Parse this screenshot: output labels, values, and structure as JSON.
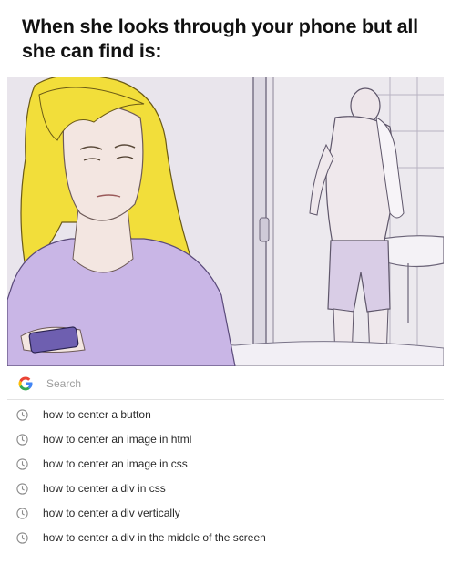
{
  "meme": {
    "caption": "When she looks through your phone but all she can find is:"
  },
  "illustration": {
    "description_icon": "comic-couple-illustration"
  },
  "search": {
    "logo_icon": "google-g-icon",
    "placeholder": "Search"
  },
  "suggestions": [
    {
      "text": "how to center a button",
      "icon": "history-clock-icon"
    },
    {
      "text": "how to center an image in html",
      "icon": "history-clock-icon"
    },
    {
      "text": "how to center an image in css",
      "icon": "history-clock-icon"
    },
    {
      "text": "how to center a div in css",
      "icon": "history-clock-icon"
    },
    {
      "text": "how to center a div vertically",
      "icon": "history-clock-icon"
    },
    {
      "text": "how to center a div in the middle of the screen",
      "icon": "history-clock-icon"
    }
  ],
  "colors": {
    "hair": "#f2de3a",
    "shirt": "#c9b6e6",
    "skin": "#f3e6e1",
    "wall": "#ece9ee",
    "phone": "#6e5fb0",
    "google_blue": "#4285f4",
    "google_red": "#ea4335",
    "google_yellow": "#fbbc05",
    "google_green": "#34a853"
  }
}
